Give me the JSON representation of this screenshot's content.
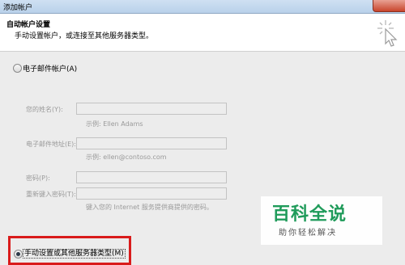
{
  "window": {
    "title": "添加帐户"
  },
  "header": {
    "title": "自动帐户设置",
    "subtitle": "手动设置帐户，或连接至其他服务器类型。"
  },
  "options": {
    "email_account": "电子邮件帐户(A)",
    "manual_setup": "手动设置或其他服务器类型(M)",
    "manual_setup_selected": true
  },
  "form": {
    "name_label": "您的姓名(Y):",
    "name_hint": "示例: Ellen Adams",
    "email_label": "电子邮件地址(E):",
    "email_hint": "示例: ellen@contoso.com",
    "password_label": "密码(P):",
    "retype_label": "重新键入密码(T):",
    "password_hint": "键入您的 Internet 服务提供商提供的密码。"
  },
  "watermark": {
    "logo": "百科全说",
    "slogan": "助你轻松解决"
  },
  "colors": {
    "highlight": "#d91b1b",
    "watermark": "#1f9b5a"
  }
}
